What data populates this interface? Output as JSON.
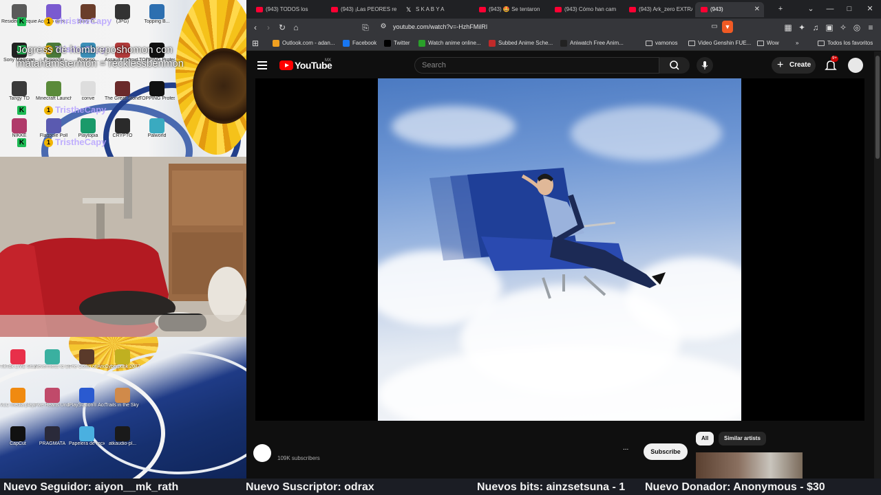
{
  "stream_overlay": {
    "chat": {
      "usernames": [
        "christheCapy",
        "TristheCapy",
        "TristheCapy",
        "TristheCapy",
        "TristheCapy"
      ],
      "message": "Jogress de hombreposhomon con matahamstermon = recklessbenmon"
    },
    "ticker": [
      "Nuevo Seguidor: aiyon__mk_rath",
      "Nuevo Suscriptor: odrax",
      "Nuevos bits: ainzsetsuna - 1",
      "Nuevo Donador: Anonymous - $30"
    ]
  },
  "desktop": {
    "top_icons": [
      {
        "label": "Resident Requiem",
        "color": "#5a5a5a"
      },
      {
        "label": "Acceso direc...",
        "color": "#7a5ad0"
      },
      {
        "label": "Story Ti...",
        "color": "#6a3d2a"
      },
      {
        "label": "(JPG)",
        "color": "#333333"
      },
      {
        "label": "Topping B...",
        "color": "#2d6fb0"
      },
      {
        "label": "Sony Magician",
        "color": "#222222"
      },
      {
        "label": "FusionSir",
        "color": "#4a7a3a"
      },
      {
        "label": "Proceso...",
        "color": "#3b8fb8"
      },
      {
        "label": "Assault Android...",
        "color": "#b03a3a"
      },
      {
        "label": "TOPPING Professio...",
        "color": "#111111"
      },
      {
        "label": "Tangy TD",
        "color": "#3a3a3a"
      },
      {
        "label": "Minecraft Launcher",
        "color": "#5a8a3a"
      },
      {
        "label": "conve",
        "color": "#dddddd"
      },
      {
        "label": "The Great Stone...",
        "color": "#6a2a2a"
      },
      {
        "label": "TOPPING Professio...",
        "color": "#111111"
      },
      {
        "label": "NIKKE",
        "color": "#b03a6a"
      },
      {
        "label": "Flagpole Poll",
        "color": "#5a5ab0"
      },
      {
        "label": "Playtopia",
        "color": "#1a9a6a"
      },
      {
        "label": "CRYPTO",
        "color": "#2a2a2a"
      },
      {
        "label": "Palworld",
        "color": "#3aaac0"
      }
    ],
    "bottom_icons": [
      {
        "label": "TikTok LIVE Studio",
        "color": "#e8304a"
      },
      {
        "label": "Nevermess to Everness",
        "color": "#3ab0a0"
      },
      {
        "label": "The Coffin of Andy and L...",
        "color": "#5a3a2a"
      },
      {
        "label": "Cyberpunk 2077",
        "color": "#c0b020"
      },
      {
        "label": "VLC media player",
        "color": "#f08a10"
      },
      {
        "label": "Five Hearts Under O...",
        "color": "#c04a6a"
      },
      {
        "label": "PlayStation® Accessories",
        "color": "#2a5ad0"
      },
      {
        "label": "Trails in the Sky 1st Ch...",
        "color": "#d08a4a"
      },
      {
        "label": "CapCut",
        "color": "#111111"
      },
      {
        "label": "PRAGMATA",
        "color": "#2a2a3a"
      },
      {
        "label": "Papelera de reciclaje",
        "color": "#4ab0e0"
      },
      {
        "label": "atkaudio-pl...",
        "color": "#1a1a1a"
      }
    ]
  },
  "browser": {
    "tabs": [
      {
        "title": "(943) TODOS los",
        "favicon": "youtube"
      },
      {
        "title": "(943) ¡Las PEORES re",
        "favicon": "youtube"
      },
      {
        "title": "S K A B Y A",
        "favicon": "x"
      },
      {
        "title": "(943) 🤩 Se tentaron",
        "favicon": "youtube"
      },
      {
        "title": "(943) Cómo han cam",
        "favicon": "youtube"
      },
      {
        "title": "(943) Ark_zero EXTRA",
        "favicon": "youtube"
      },
      {
        "title": "(943)",
        "favicon": "youtube",
        "active": true
      }
    ],
    "url": "youtube.com/watch?v=-HzhFMilRI",
    "bookmarks": [
      {
        "label": "Outlook.com - adan...",
        "color": "#f0a020"
      },
      {
        "label": "Facebook",
        "color": "#1877f2"
      },
      {
        "label": "Twitter",
        "color": "#000000"
      },
      {
        "label": "Watch anime online...",
        "color": "#2aa02a"
      },
      {
        "label": "Subbed Anime Sche...",
        "color": "#c02a2a"
      },
      {
        "label": "Aniwatch Free Anim...",
        "color": "#222222"
      },
      {
        "label": "vamonos",
        "color": "folder"
      },
      {
        "label": "Video Genshin FUE...",
        "color": "folder"
      },
      {
        "label": "Wow",
        "color": "folder"
      }
    ],
    "all_bookmarks": "Todos los favoritos"
  },
  "youtube": {
    "logo": "YouTube",
    "region": "MX",
    "search_placeholder": "Search",
    "create_label": "Create",
    "notifications": "9+",
    "subscribers": "109K subscribers",
    "more": "...",
    "subscribe_label": "Subscribe",
    "chips": [
      "All",
      "Similar artists"
    ]
  },
  "colors": {
    "youtube_red": "#ff0000",
    "kick_green": "#1db954",
    "browser_chrome": "#35363a"
  }
}
